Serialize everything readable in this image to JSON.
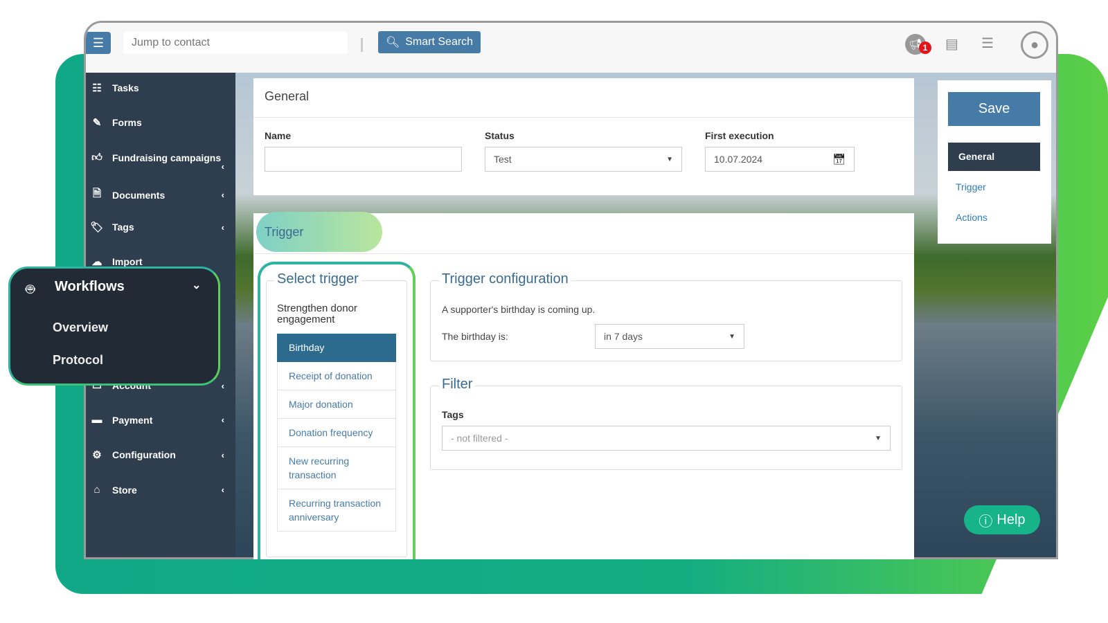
{
  "topbar": {
    "search_placeholder": "Jump to contact",
    "smart_search": "Smart Search",
    "notification_count": "1"
  },
  "sidebar": {
    "items": [
      {
        "label": "Tasks",
        "icon": "tasks-icon"
      },
      {
        "label": "Forms",
        "icon": "edit-icon"
      },
      {
        "label": "Fundraising campaigns",
        "icon": "thumbs-up-icon"
      },
      {
        "label": "Documents",
        "icon": "document-icon"
      },
      {
        "label": "Tags",
        "icon": "tags-icon"
      },
      {
        "label": "Import",
        "icon": "cloud-upload-icon"
      },
      {
        "label": "Account",
        "icon": "account-icon"
      },
      {
        "label": "Payment",
        "icon": "credit-card-icon"
      },
      {
        "label": "Configuration",
        "icon": "gear-icon"
      },
      {
        "label": "Store",
        "icon": "store-icon"
      }
    ],
    "workflows": {
      "label": "Workflows",
      "sub": [
        "Overview",
        "Protocol"
      ]
    }
  },
  "general": {
    "title": "General",
    "name_label": "Name",
    "name_value": "",
    "status_label": "Status",
    "status_value": "Test",
    "first_exec_label": "First execution",
    "first_exec_value": "10.07.2024"
  },
  "trigger": {
    "title": "Trigger",
    "select_title": "Select trigger",
    "group": "Strengthen donor engagement",
    "options": [
      "Birthday",
      "Receipt of donation",
      "Major donation",
      "Donation frequency",
      "New recurring transaction",
      "Recurring transaction anniversary"
    ],
    "config_title": "Trigger configuration",
    "config_desc": "A supporter's birthday is coming up.",
    "birthday_label": "The birthday is:",
    "birthday_value": "in 7 days",
    "filter_title": "Filter",
    "tags_label": "Tags",
    "tags_value": "- not filtered -"
  },
  "rightnav": {
    "save": "Save",
    "items": [
      "General",
      "Trigger",
      "Actions"
    ]
  },
  "help": "Help",
  "colors": {
    "primary": "#467ba8",
    "sidebar": "#2e3e4f",
    "accent": "#17b48a"
  }
}
